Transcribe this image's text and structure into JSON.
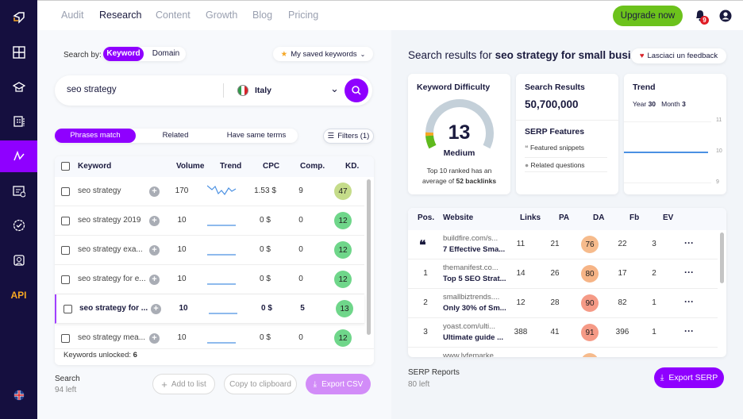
{
  "sidebar": {
    "items": [
      {
        "icon": "logo-icon"
      },
      {
        "icon": "dashboard-icon"
      },
      {
        "icon": "academy-icon"
      },
      {
        "icon": "reports-icon"
      },
      {
        "icon": "research-icon",
        "active": true
      },
      {
        "icon": "audit-icon"
      },
      {
        "icon": "monitor-icon"
      },
      {
        "icon": "profile-icon"
      },
      {
        "label": "API"
      },
      {
        "icon": "uk-flag-icon"
      }
    ]
  },
  "topbar": {
    "nav": [
      "Audit",
      "Research",
      "Content",
      "Growth",
      "Blog",
      "Pricing"
    ],
    "active": "Research",
    "upgrade": "Upgrade now",
    "notifications": "9"
  },
  "search": {
    "search_by_label": "Search by:",
    "modes": [
      "Keyword",
      "Domain"
    ],
    "active_mode": "Keyword",
    "saved": "My saved keywords",
    "query": "seo strategy",
    "country": "Italy"
  },
  "match_tabs": [
    "Phrases match",
    "Related",
    "Have same terms"
  ],
  "filters": "Filters (1)",
  "keywords": {
    "headers": [
      "Keyword",
      "Volume",
      "Trend",
      "CPC",
      "Comp.",
      "KD."
    ],
    "rows": [
      {
        "keyword": "seo strategy",
        "volume": "170",
        "cpc": "1.53 $",
        "comp": "9",
        "kd": "47",
        "kd_color": "#c5dc8a"
      },
      {
        "keyword": "seo strategy 2019",
        "volume": "10",
        "cpc": "0 $",
        "comp": "0",
        "kd": "12",
        "kd_color": "#6fd68a"
      },
      {
        "keyword": "seo strategy exa...",
        "volume": "10",
        "cpc": "0 $",
        "comp": "0",
        "kd": "12",
        "kd_color": "#6fd68a"
      },
      {
        "keyword": "seo strategy for e...",
        "volume": "10",
        "cpc": "0 $",
        "comp": "0",
        "kd": "12",
        "kd_color": "#6fd68a"
      },
      {
        "keyword": "seo strategy for ...",
        "volume": "10",
        "cpc": "0 $",
        "comp": "5",
        "kd": "13",
        "kd_color": "#6fd68a",
        "selected": true
      },
      {
        "keyword": "seo strategy mea...",
        "volume": "10",
        "cpc": "0 $",
        "comp": "0",
        "kd": "12",
        "kd_color": "#6fd68a"
      }
    ],
    "unlocked_label": "Keywords unlocked:",
    "unlocked": "6"
  },
  "left_footer": {
    "search_label": "Search",
    "search_left": "94 left",
    "add_to_list": "Add to list",
    "copy": "Copy to clipboard",
    "export": "Export CSV"
  },
  "results": {
    "prefix": "Search results for",
    "query": "seo strategy for small busi...",
    "feedback": "Lasciaci un feedback"
  },
  "kd_card": {
    "title": "Keyword Difficulty",
    "value": 13,
    "level": "Medium",
    "note_prefix": "Top 10 ranked has an average of",
    "note_bold": "52 backlinks"
  },
  "search_results": {
    "title": "Search Results",
    "value": "50,700,000"
  },
  "serp_features": {
    "title": "SERP Features",
    "items": [
      "Featured snippets",
      "Related questions"
    ]
  },
  "trend": {
    "title": "Trend",
    "year_label": "Year",
    "year": "30",
    "month_label": "Month",
    "month": "3",
    "yticks": [
      "11",
      "10",
      "9"
    ]
  },
  "serp": {
    "headers": [
      "Pos.",
      "Website",
      "Links",
      "PA",
      "DA",
      "Fb",
      "EV"
    ],
    "rows": [
      {
        "pos": "featured-snippet-icon",
        "url": "buildfire.com/s...",
        "title": "7 Effective Sma...",
        "links": "11",
        "pa": "21",
        "da": "76",
        "da_color": "#f6bb8c",
        "fb": "22",
        "ev": "3"
      },
      {
        "pos": "1",
        "url": "themanifest.co...",
        "title": "Top 5 SEO Strat...",
        "links": "14",
        "pa": "26",
        "da": "80",
        "da_color": "#f6b486",
        "fb": "17",
        "ev": "2"
      },
      {
        "pos": "2",
        "url": "smallbiztrends....",
        "title": "Only 30% of Sm...",
        "links": "12",
        "pa": "28",
        "da": "90",
        "da_color": "#f59a86",
        "fb": "82",
        "ev": "1"
      },
      {
        "pos": "3",
        "url": "yoast.com/ulti...",
        "title": "Ultimate guide ...",
        "links": "388",
        "pa": "41",
        "da": "91",
        "da_color": "#f59a86",
        "fb": "396",
        "ev": "1"
      },
      {
        "pos": "",
        "url": "www.lyfemarke...",
        "title": "",
        "links": "",
        "pa": "",
        "da": "",
        "da_color": "#f6bb8c",
        "fb": "",
        "ev": ""
      }
    ]
  },
  "right_footer": {
    "label": "SERP Reports",
    "left": "80 left",
    "export": "Export SERP"
  },
  "colors": {
    "accent": "#8f00ff",
    "sidebar": "#150f3f",
    "upgrade": "#6cc21c"
  }
}
